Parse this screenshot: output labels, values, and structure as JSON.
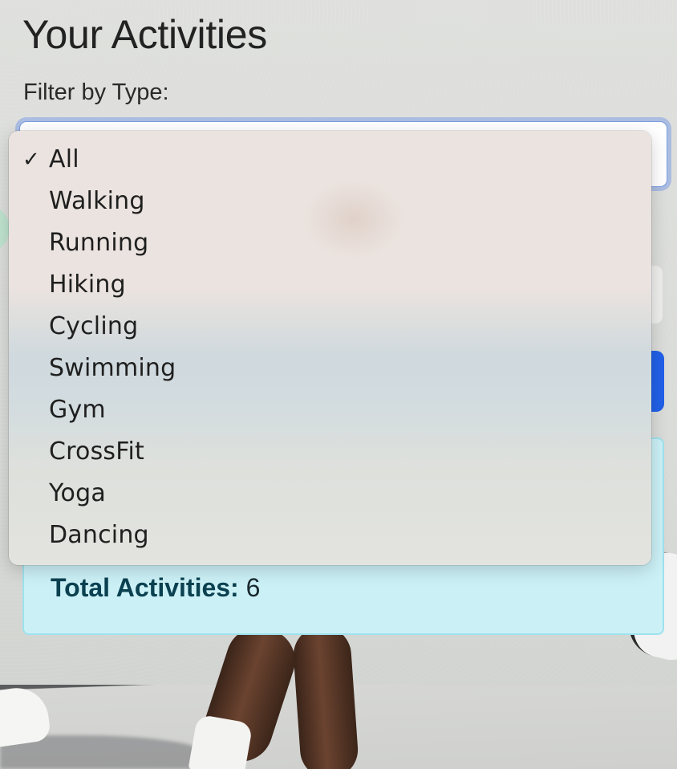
{
  "page": {
    "title": "Your Activities",
    "filter_label": "Filter by Type:"
  },
  "filter": {
    "selected": "All",
    "options": [
      "All",
      "Walking",
      "Running",
      "Hiking",
      "Cycling",
      "Swimming",
      "Gym",
      "CrossFit",
      "Yoga",
      "Dancing"
    ]
  },
  "summary": {
    "total_label": "Total Activities:",
    "total_value": "6"
  },
  "icons": {
    "selected_marker": "checkmark-icon"
  },
  "colors": {
    "accent_button": "#2260e8",
    "summary_bg": "#cbf1f7",
    "summary_text": "#0b4150",
    "focus_ring": "#7b9ee0"
  }
}
